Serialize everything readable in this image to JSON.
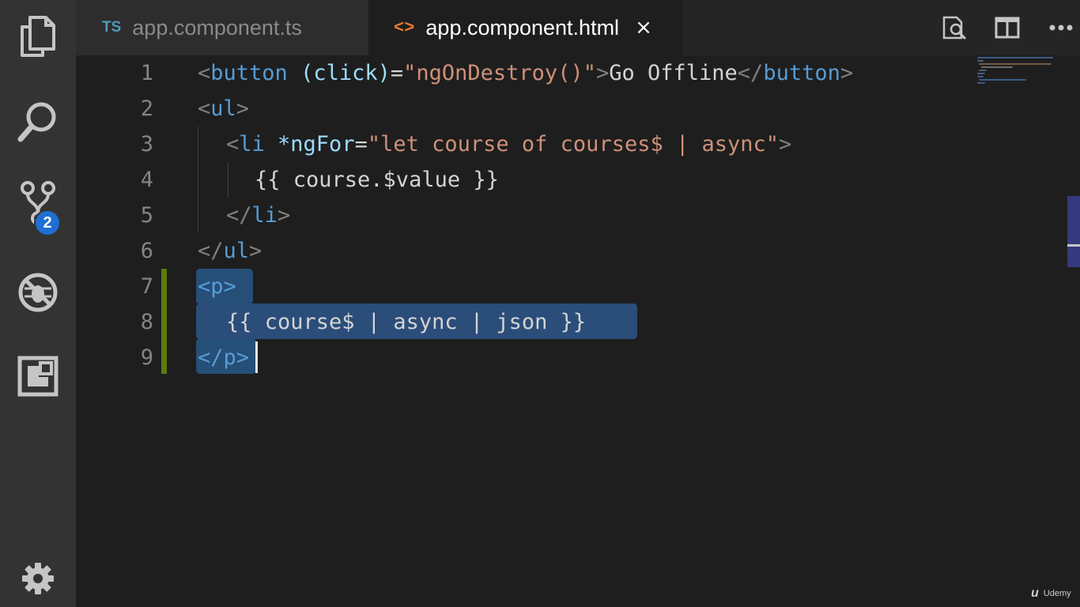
{
  "activity_bar": {
    "items": [
      {
        "icon": "files-icon"
      },
      {
        "icon": "search-icon"
      },
      {
        "icon": "source-control-icon",
        "badge": "2"
      },
      {
        "icon": "debug-icon"
      },
      {
        "icon": "extensions-icon"
      }
    ],
    "settings_icon": "gear-icon"
  },
  "tabs": [
    {
      "lang_badge": "TS",
      "label": "app.component.ts",
      "active": false
    },
    {
      "lang_badge": "<>",
      "label": "app.component.html",
      "active": true,
      "close": "×"
    }
  ],
  "editor_actions": [
    "open-preview-icon",
    "split-editor-icon",
    "more-actions-icon"
  ],
  "editor": {
    "line_numbers": [
      "1",
      "2",
      "3",
      "4",
      "5",
      "6",
      "7",
      "8",
      "9"
    ],
    "tokens": {
      "l1": {
        "t1": "<",
        "t2": "button",
        "t3": " (click)",
        "t4": "=",
        "t5": "\"ngOnDestroy()\"",
        "t6": ">",
        "t7": "Go Offline",
        "t8": "</",
        "t9": "button",
        "t10": ">"
      },
      "l2": {
        "t1": "<",
        "t2": "ul",
        "t3": ">"
      },
      "l3": {
        "t1": "<",
        "t2": "li",
        "t3": " *ngFor",
        "t4": "=",
        "t5": "\"let course of courses$ | async\"",
        "t6": ">"
      },
      "l4": {
        "t1": "{{ course.$value }}"
      },
      "l5": {
        "t1": "</",
        "t2": "li",
        "t3": ">"
      },
      "l6": {
        "t1": "</",
        "t2": "ul",
        "t3": ">"
      },
      "l7": {
        "t1": "<",
        "t2": "p",
        "t3": ">"
      },
      "l8": {
        "t1": "{{ course$ | async | json }}"
      },
      "l9": {
        "t1": "</",
        "t2": "p",
        "t3": ">"
      }
    }
  },
  "watermark": {
    "mark": "u",
    "text": "Udemy"
  },
  "colors": {
    "selection": "#264f78",
    "tag": "#569cd6",
    "string": "#ce9178",
    "attribute": "#9cdcfe",
    "badge": "#1f6fd3",
    "git_modified": "#587c0c"
  }
}
